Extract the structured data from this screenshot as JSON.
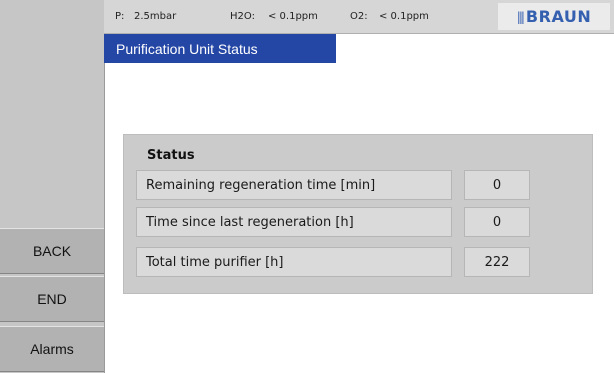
{
  "header": {
    "pressure_label": "P:",
    "pressure_value": "2.5mbar",
    "h2o_label": "H2O:",
    "h2o_value": "< 0.1ppm",
    "o2_label": "O2:",
    "o2_value": "< 0.1ppm",
    "logo_mark": "|||",
    "logo_text": "BRAUN"
  },
  "page_title": "Purification Unit Status",
  "sidebar": {
    "buttons": [
      {
        "label": "BACK"
      },
      {
        "label": "END"
      },
      {
        "label": "Alarms"
      }
    ]
  },
  "status": {
    "title": "Status",
    "rows": [
      {
        "label": "Remaining regeneration time [min]",
        "value": "0"
      },
      {
        "label": "Time since last regeneration [h]",
        "value": "0"
      },
      {
        "label": "Total time purifier [h]",
        "value": "222"
      }
    ]
  },
  "colors": {
    "title_tab": "#2446a5",
    "logo": "#3560b0",
    "sidebar": "#c6c6c6",
    "panel": "#cbcbcb"
  }
}
